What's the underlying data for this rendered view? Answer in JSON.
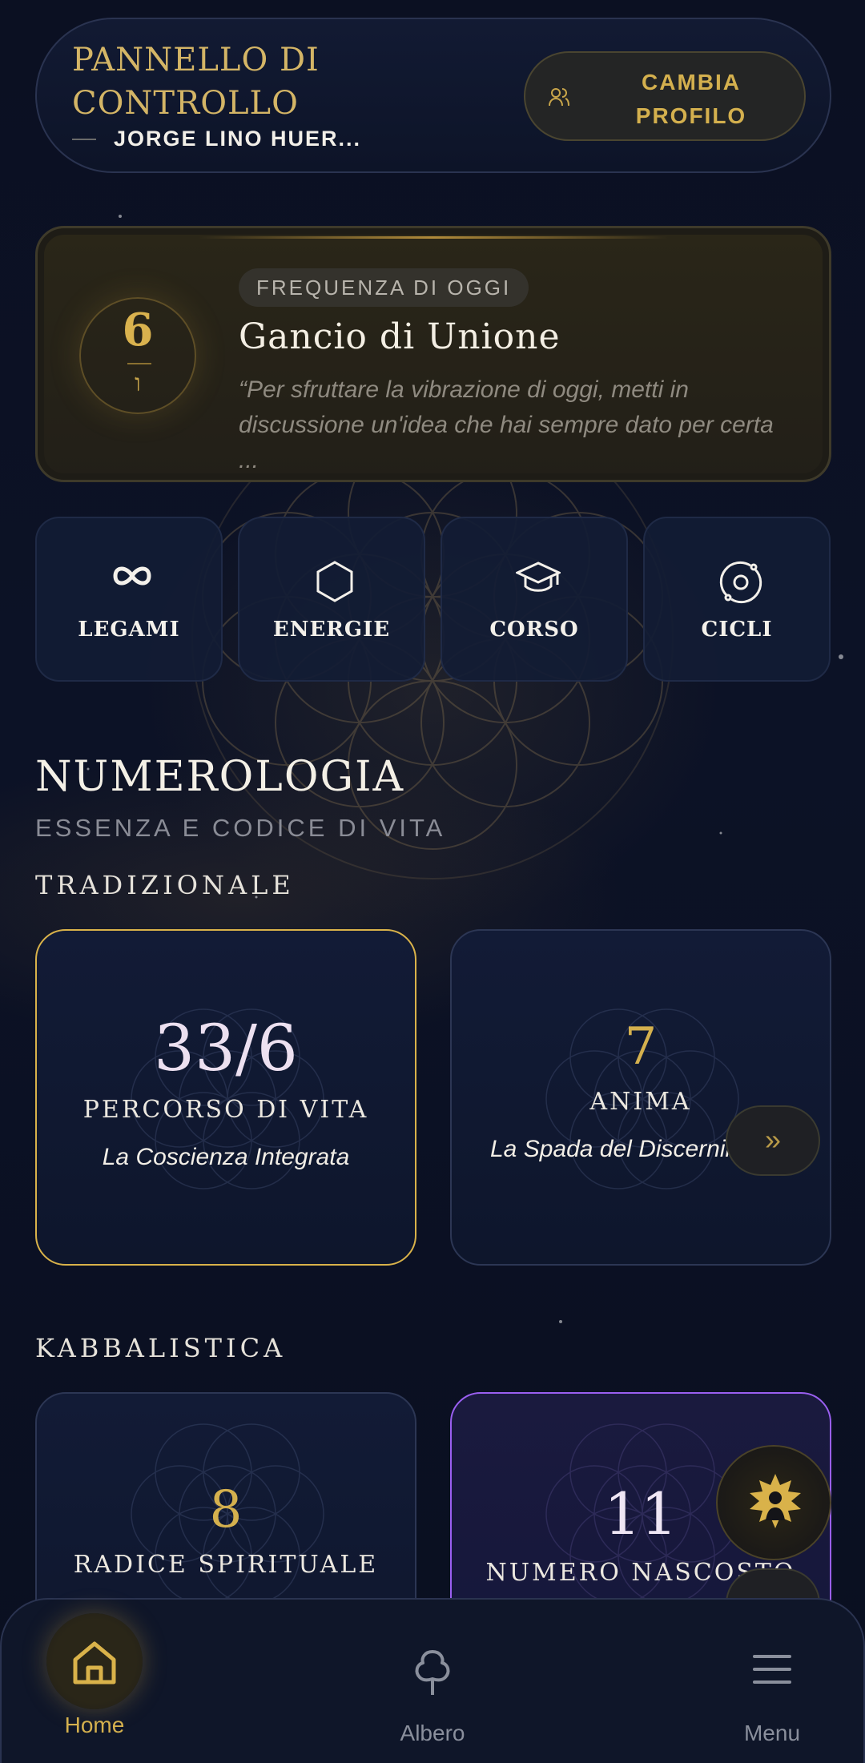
{
  "colors": {
    "accent_gold": "#d4b04e",
    "background": "#0b1022",
    "violet": "#9a5ff0"
  },
  "header": {
    "title": "PANNELLO DI CONTROLLO",
    "user_name": "JORGE LINO HUER...",
    "change_profile_label": "CAMBIA PROFILO",
    "change_profile_icon": "users-icon"
  },
  "daily": {
    "badge": "FREQUENZA DI OGGI",
    "number": "6",
    "hebrew_letter": "ו",
    "name": "Gancio di Unione",
    "quote": "“Per sfruttare la vibrazione di oggi, metti in discussione un'idea che hai sempre dato per certa ..."
  },
  "tiles": [
    {
      "label": "LEGAMI",
      "icon": "infinity-icon"
    },
    {
      "label": "ENERGIE",
      "icon": "hexagon-icon"
    },
    {
      "label": "CORSO",
      "icon": "graduation-cap-icon"
    },
    {
      "label": "CICLI",
      "icon": "orbit-icon"
    }
  ],
  "numerology": {
    "title": "NUMEROLOGIA",
    "subtitle": "ESSENZA E CODICE DI VITA",
    "traditional": {
      "heading": "TRADIZIONALE",
      "cards": [
        {
          "number": "33/6",
          "label": "PERCORSO DI VITA",
          "desc": "La Coscienza Integrata"
        },
        {
          "number": "7",
          "label": "ANIMA",
          "desc": "La Spada del Discernimento"
        }
      ]
    },
    "kabbalistic": {
      "heading": "KABBALISTICA",
      "cards": [
        {
          "number": "8",
          "label": "RADICE SPIRITUALE"
        },
        {
          "number": "11",
          "label": "NUMERO NASCOSTO"
        }
      ]
    },
    "next_icon": "chevrons-right-icon"
  },
  "nav": {
    "items": [
      {
        "label": "Home",
        "icon": "home-icon",
        "active": true
      },
      {
        "label": "Albero",
        "icon": "tree-icon",
        "active": false
      },
      {
        "label": "Menu",
        "icon": "menu-icon",
        "active": false
      }
    ]
  }
}
